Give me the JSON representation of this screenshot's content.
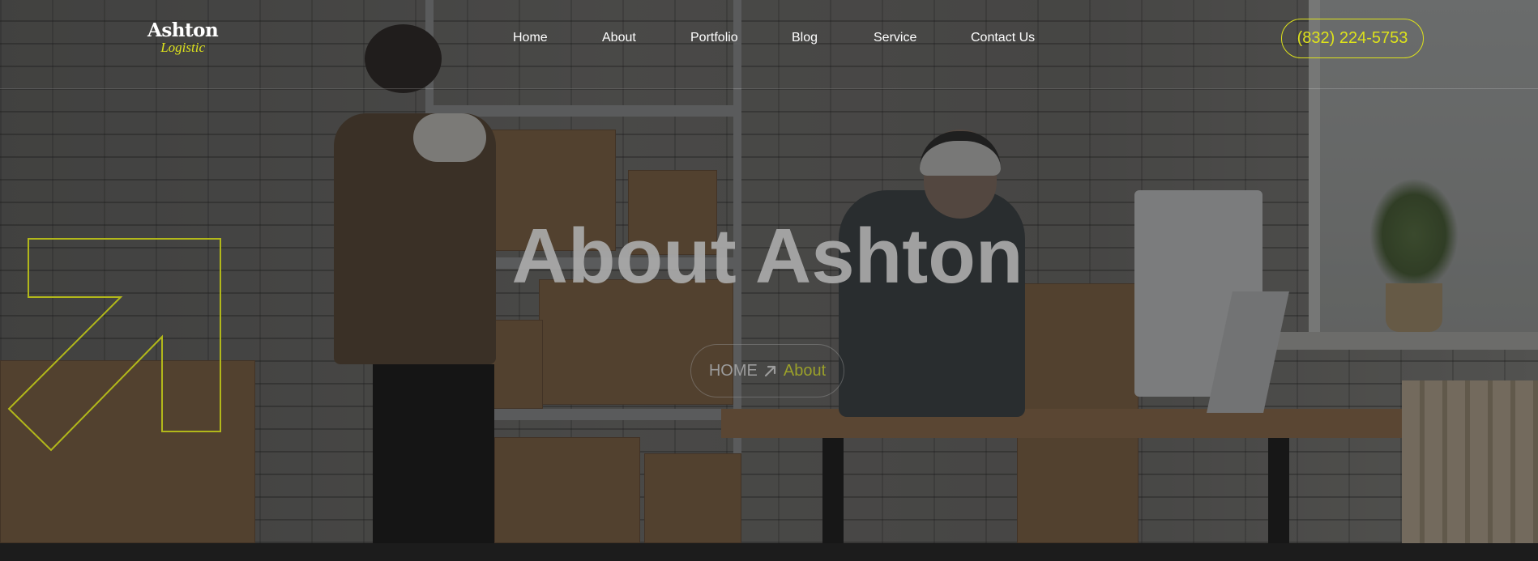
{
  "brand": {
    "name": "Ashton",
    "tagline": "Logistic",
    "accent_color": "#dde21c"
  },
  "nav": {
    "items": [
      {
        "label": "Home"
      },
      {
        "label": "About"
      },
      {
        "label": "Portfolio"
      },
      {
        "label": "Blog"
      },
      {
        "label": "Service"
      },
      {
        "label": "Contact Us"
      }
    ]
  },
  "header": {
    "phone": "(832) 224-5753"
  },
  "hero": {
    "title": "About Ashton",
    "background_image": "warehouse-workers-photo",
    "decoration_icon": "arrow-up-right-outline-icon"
  },
  "breadcrumb": {
    "home": "HOME",
    "separator_icon": "arrow-up-right-icon",
    "current": "About"
  }
}
